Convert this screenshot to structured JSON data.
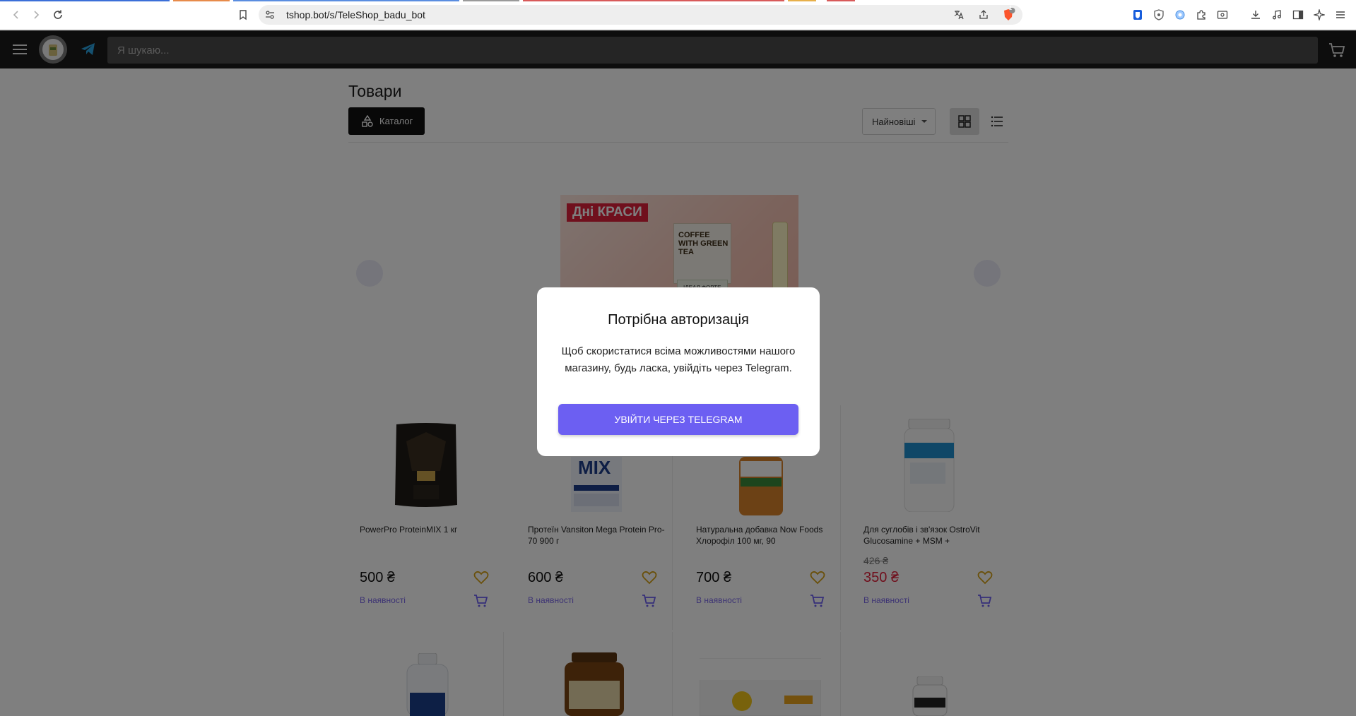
{
  "browser": {
    "url": "tshop.bot/s/TeleShop_badu_bot",
    "shield_badge": "1"
  },
  "header": {
    "search_placeholder": "Я шукаю..."
  },
  "page": {
    "title": "Товари",
    "catalog_label": "Каталог",
    "sort_label": "Найновіші"
  },
  "banner": {
    "tag": "Дні КРАСИ",
    "box_text": "COFFEE WITH GREEN TEA",
    "small_text": "ІДЕАЛ ФОРТЕ"
  },
  "products": [
    {
      "name": "PowerPro ProteinMIX 1 кг",
      "price": "500 ₴",
      "old_price": "",
      "stock": "В наявності"
    },
    {
      "name": "Протеїн Vansiton Mega Protein Pro-70 900 г",
      "price": "600 ₴",
      "old_price": "",
      "stock": "В наявності"
    },
    {
      "name": "Натуральна добавка Now Foods Хлорофіл 100 мг, 90",
      "price": "700 ₴",
      "old_price": "",
      "stock": "В наявності"
    },
    {
      "name": "Для суглобів і зв'язок OstroVit Glucosamine + MSM +",
      "price": "350 ₴",
      "old_price": "426 ₴",
      "stock": "В наявності"
    }
  ],
  "modal": {
    "title": "Потрібна авторизація",
    "text": "Щоб скористатися всіма можливостями нашого магазину, будь ласка, увійдіть через Telegram.",
    "button": "УВІЙТИ ЧЕРЕЗ TELEGRAM"
  },
  "colors": {
    "accent": "#6c5ff2",
    "sale": "#e0203a",
    "stock": "#7a67e8",
    "header": "#1a1a1a"
  }
}
